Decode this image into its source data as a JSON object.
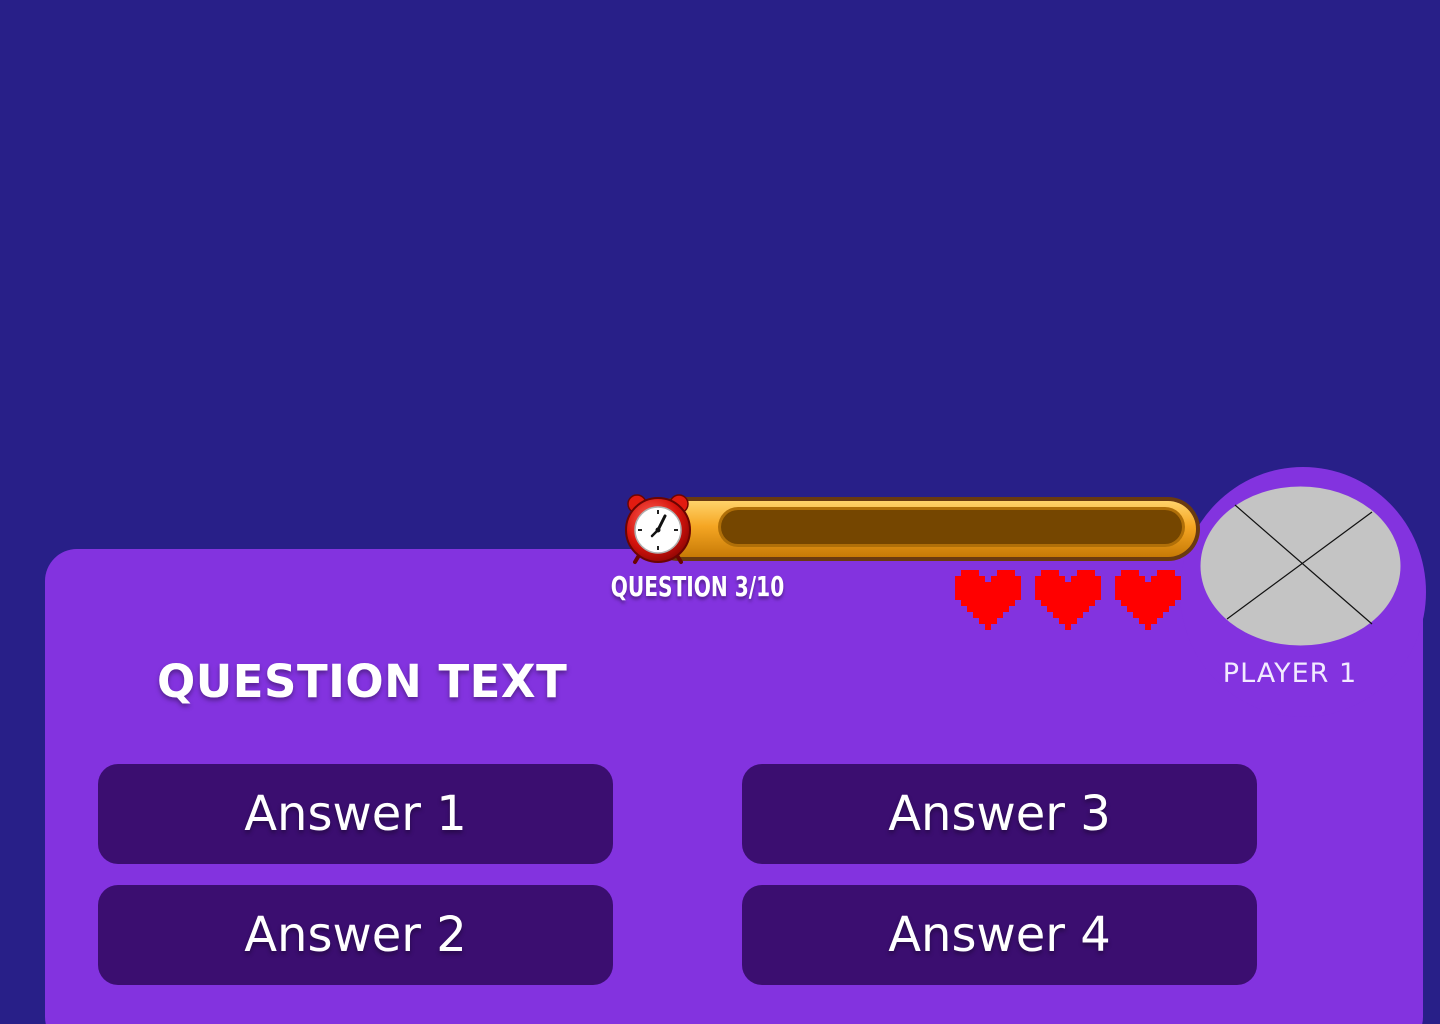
{
  "colors": {
    "background": "#281f88",
    "panel": "#8333df",
    "answer_button": "#3b0e70",
    "timer_frame": "#f5a623",
    "timer_track": "#754600",
    "heart": "#ff0000",
    "avatar_placeholder": "#c4c4c4"
  },
  "timer": {
    "icon": "alarm-clock-icon",
    "remaining_fraction": 0
  },
  "hud": {
    "question_counter": "QUESTION 3/10",
    "lives": [
      {
        "icon": "heart-icon"
      },
      {
        "icon": "heart-icon"
      },
      {
        "icon": "heart-icon"
      }
    ]
  },
  "player": {
    "name": "PLAYER 1",
    "avatar": "avatar-placeholder"
  },
  "question": {
    "text": "QUESTION TEXT"
  },
  "answers": [
    {
      "label": "Answer 1"
    },
    {
      "label": "Answer 2"
    },
    {
      "label": "Answer 3"
    },
    {
      "label": "Answer 4"
    }
  ]
}
